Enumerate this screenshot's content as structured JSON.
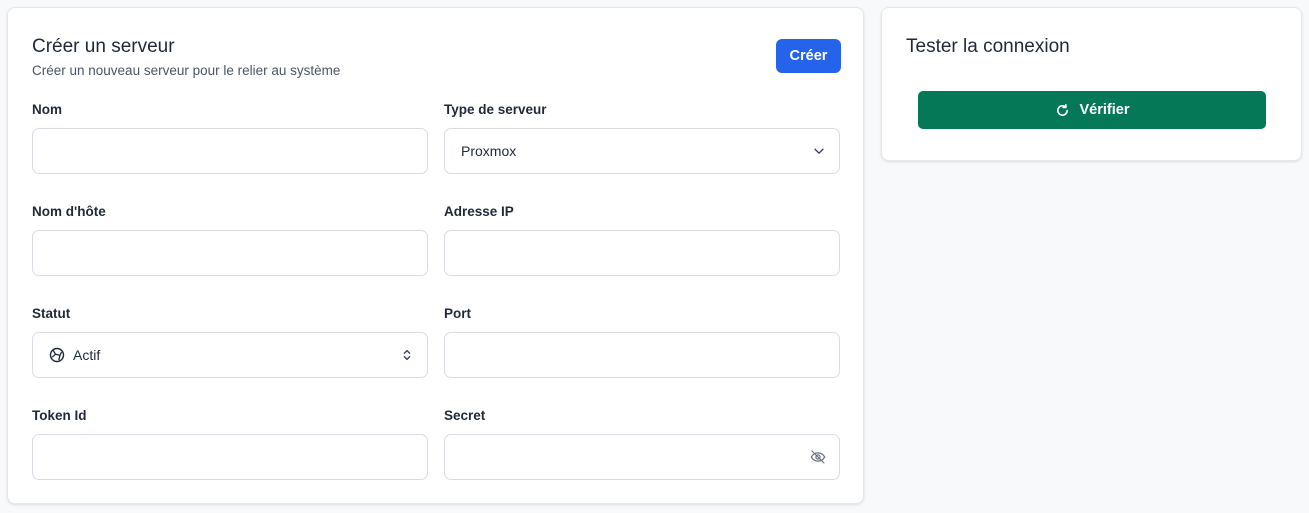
{
  "create_card": {
    "title": "Créer un serveur",
    "subtitle": "Créer un nouveau serveur pour le relier au système",
    "create_button": "Créer",
    "fields": {
      "name": {
        "label": "Nom",
        "value": "",
        "placeholder": ""
      },
      "server_type": {
        "label": "Type de serveur",
        "selected": "Proxmox",
        "icon": "chevron-down-icon"
      },
      "hostname": {
        "label": "Nom d'hôte",
        "value": "",
        "placeholder": ""
      },
      "ip_address": {
        "label": "Adresse IP",
        "value": "",
        "placeholder": ""
      },
      "status": {
        "label": "Statut",
        "selected": "Actif",
        "icon": "status-globe-icon",
        "toggle_icon": "chevron-updown-icon"
      },
      "port": {
        "label": "Port",
        "value": "",
        "placeholder": ""
      },
      "token_id": {
        "label": "Token Id",
        "value": "",
        "placeholder": ""
      },
      "secret": {
        "label": "Secret",
        "value": "",
        "placeholder": "",
        "icon": "eye-off-icon"
      }
    }
  },
  "test_card": {
    "title": "Tester la connexion",
    "verify_button": "Vérifier",
    "verify_icon": "refresh-icon"
  },
  "colors": {
    "primary": "#2563eb",
    "success": "#047857",
    "background": "#f8f9fb",
    "border": "#d8dce2"
  }
}
